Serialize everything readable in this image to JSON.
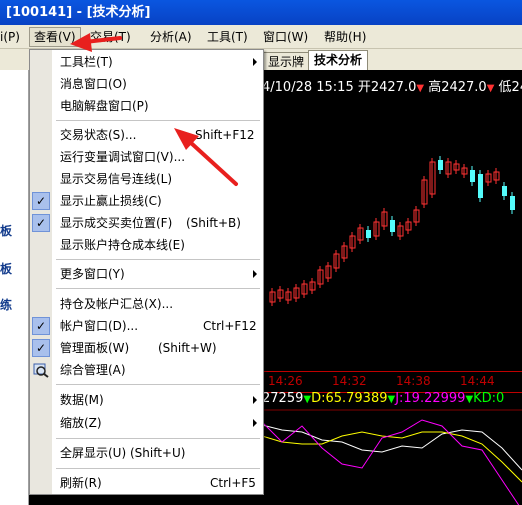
{
  "window": {
    "title": "[100141] - [技术分析]"
  },
  "menubar": {
    "items": [
      "查看(V)",
      "交易(T)",
      "分析(A)",
      "工具(T)",
      "窗口(W)",
      "帮助(H)"
    ],
    "left_partial": "i(P)",
    "open_item": "查看(V)"
  },
  "tabs": {
    "items": [
      "显示牌",
      "技术分析"
    ],
    "active": "技术分析"
  },
  "left_panel": {
    "labels": [
      "板",
      "板",
      "练"
    ]
  },
  "chart": {
    "quote": {
      "datetime": "4/10/28 15:15",
      "open": "开2427.0",
      "high": "高2427.0",
      "low": "低24"
    },
    "times": [
      "14:26",
      "14:32",
      "14:38",
      "14:44"
    ],
    "indicators": {
      "k": "27259",
      "d": "D:65.79389",
      "j": "J:19.22999",
      "kd": "KD:0"
    },
    "colors": {
      "up": "#ff3232",
      "down": "#54fcfc",
      "k_line": "#ffffff",
      "d_line": "#ffff00",
      "j_line": "#ff00ff",
      "kd_text": "#00ff00"
    }
  },
  "menu": {
    "items": [
      {
        "label": "工具栏(T)",
        "submenu": true
      },
      {
        "label": "消息窗口(O)"
      },
      {
        "label": "电脑解盘窗口(P)"
      },
      {
        "label": "交易状态(S)...",
        "shortcut": "Shift+F12"
      },
      {
        "label": "运行变量调试窗口(V)..."
      },
      {
        "label": "显示交易信号连线(L)"
      },
      {
        "label": "显示止赢止损线(C)",
        "checked": true
      },
      {
        "label": "显示成交买卖位置(F)",
        "shortcut": "(Shift+B)",
        "checked": true
      },
      {
        "label": "显示账户持仓成本线(E)"
      },
      {
        "label": "更多窗口(Y)",
        "submenu": true
      },
      {
        "label": "持仓及帐户汇总(X)..."
      },
      {
        "label": "帐户窗口(D)...",
        "shortcut": "Ctrl+F12",
        "checked": true
      },
      {
        "label": "管理面板(W)",
        "shortcut": "(Shift+W)",
        "checked": true
      },
      {
        "label": "综合管理(A)",
        "icon": "manage-icon"
      },
      {
        "label": "数据(M)",
        "submenu": true
      },
      {
        "label": "缩放(Z)",
        "submenu": true
      },
      {
        "label": "全屏显示(U) (Shift+U)"
      },
      {
        "label": "刷新(R)",
        "shortcut": "Ctrl+F5"
      }
    ]
  }
}
